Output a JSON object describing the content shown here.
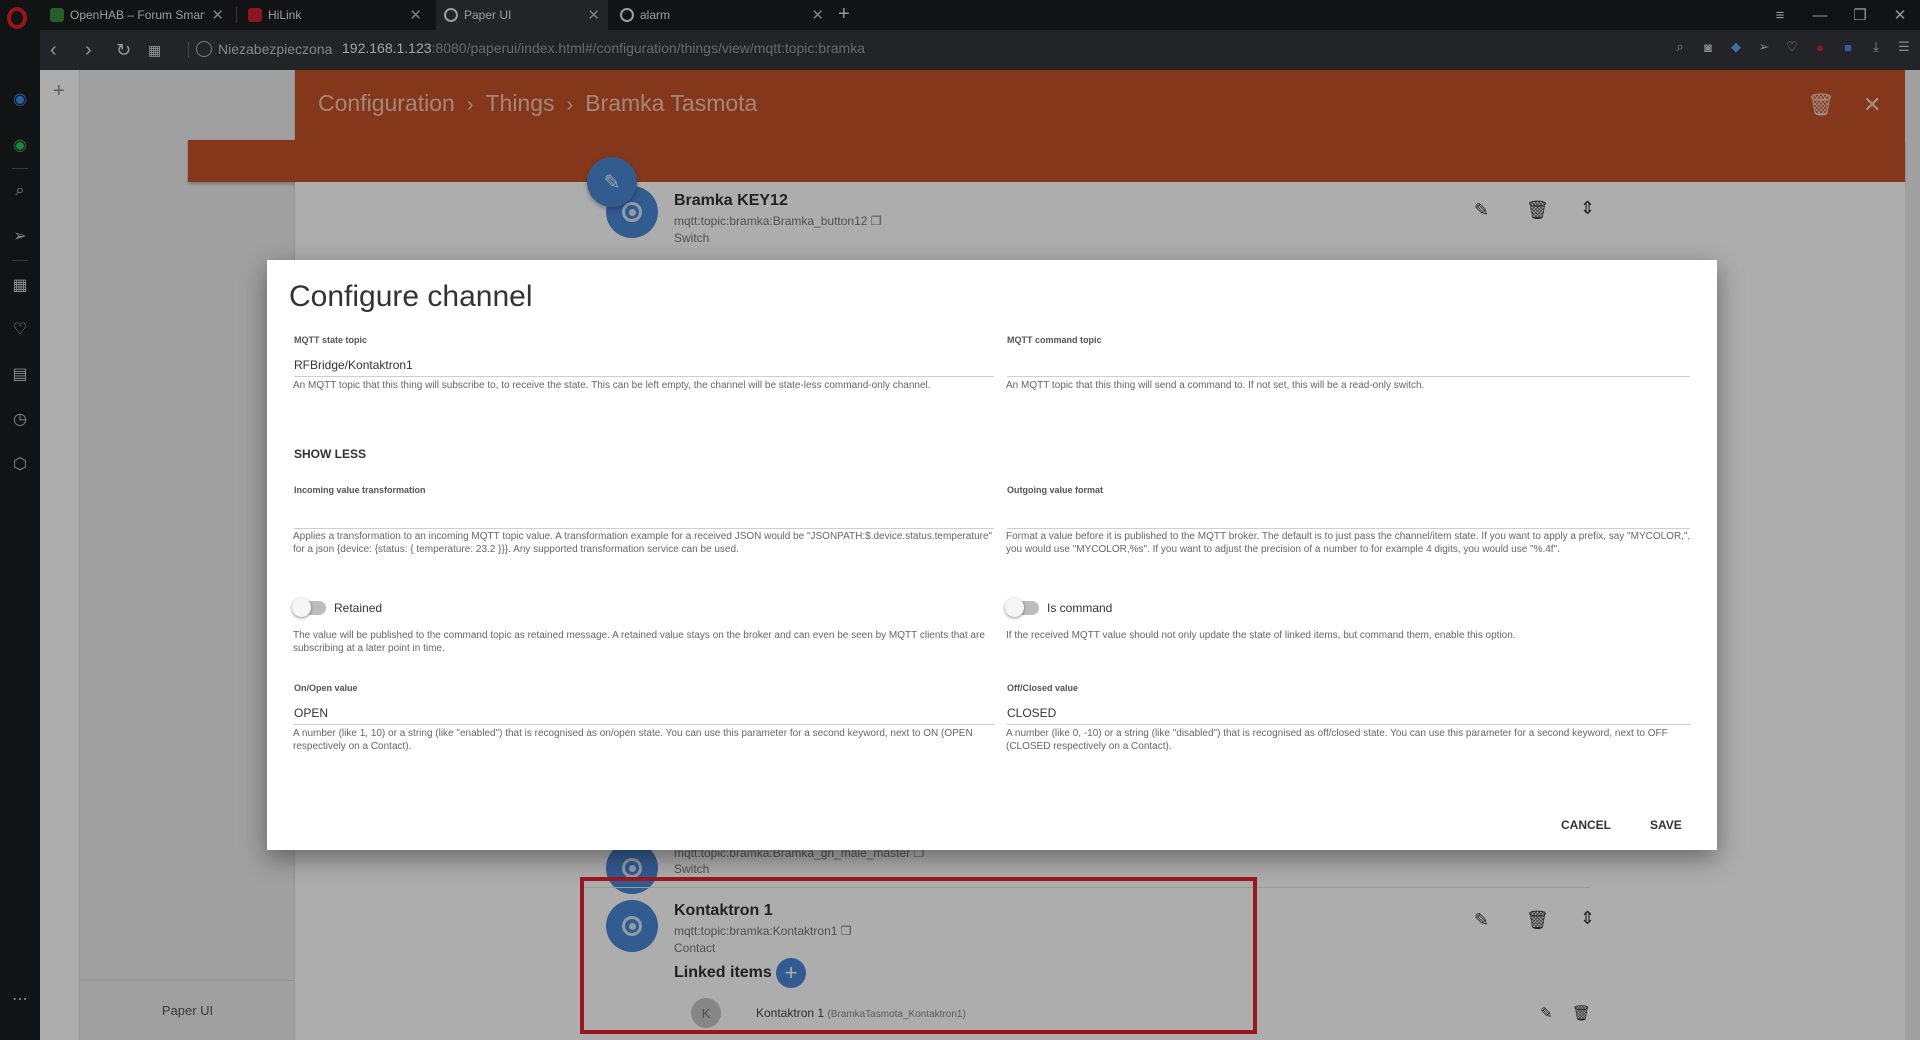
{
  "browser": {
    "tabs": [
      {
        "title": "OpenHAB – Forum Smartny",
        "favicon_color": "#3b8a3a"
      },
      {
        "title": "HiLink",
        "favicon_color": "#d01f2f"
      },
      {
        "title": "Paper UI",
        "favicon_color": "#e8e8e8"
      },
      {
        "title": "alarm",
        "favicon_color": "#e8e8e8"
      }
    ],
    "security_label": "Niezabezpieczona",
    "url_host": "192.168.1.123",
    "url_rest": ":8080/paperui/index.html#/configuration/things/view/mqtt:topic:bramka"
  },
  "app": {
    "footer_label": "Paper UI",
    "breadcrumb": [
      "Configuration",
      "Things",
      "Bramka Tasmota"
    ],
    "accent_color": "#c5512a"
  },
  "channels": [
    {
      "title": "Bramka KEY12",
      "uid": "mqtt:topic:bramka:Bramka_button12",
      "type": "Switch"
    },
    {
      "title": "",
      "uid": "mqtt:topic:bramka:Bramka_gn_male_master",
      "type": "Switch"
    },
    {
      "title": "Kontaktron 1",
      "uid": "mqtt:topic:bramka:Kontaktron1",
      "type": "Contact"
    }
  ],
  "linked": {
    "title": "Linked items",
    "item_initial": "K",
    "item_label": "Kontaktron 1",
    "item_sub": "(BramkaTasmota_Kontaktron1)"
  },
  "dialog": {
    "title": "Configure channel",
    "state_topic": {
      "label": "MQTT state topic",
      "value": "RFBridge/Kontaktron1",
      "help": "An MQTT topic that this thing will subscribe to, to receive the state. This can be left empty, the channel will be state-less command-only channel."
    },
    "command_topic": {
      "label": "MQTT command topic",
      "value": "",
      "help": "An MQTT topic that this thing will send a command to. If not set, this will be a read-only switch."
    },
    "show_less": "SHOW LESS",
    "incoming": {
      "label": "Incoming value transformation",
      "value": "",
      "help": "Applies a transformation to an incoming MQTT topic value. A transformation example for a received JSON would be \"JSONPATH:$.device.status.temperature\" for a json {device: {status: { temperature: 23.2 }}}. Any supported transformation service can be used."
    },
    "outgoing": {
      "label": "Outgoing value format",
      "value": "",
      "help": "Format a value before it is published to the MQTT broker. The default is to just pass the channel/item state. If you want to apply a prefix, say \"MYCOLOR,\", you would use \"MYCOLOR,%s\". If you want to adjust the precision of a number to for example 4 digits, you would use \"%.4f\"."
    },
    "retained": {
      "label": "Retained",
      "on": false,
      "help": "The value will be published to the command topic as retained message. A retained value stays on the broker and can even be seen by MQTT clients that are subscribing at a later point in time."
    },
    "is_command": {
      "label": "Is command",
      "on": false,
      "help": "If the received MQTT value should not only update the state of linked items, but command them, enable this option."
    },
    "on_value": {
      "label": "On/Open value",
      "value": "OPEN",
      "help": "A number (like 1, 10) or a string (like \"enabled\") that is recognised as on/open state. You can use this parameter for a second keyword, next to ON (OPEN respectively on a Contact)."
    },
    "off_value": {
      "label": "Off/Closed value",
      "value": "CLOSED",
      "help": "A number (like 0, -10) or a string (like \"disabled\") that is recognised as off/closed state. You can use this parameter for a second keyword, next to OFF (CLOSED respectively on a Contact)."
    },
    "cancel_label": "CANCEL",
    "save_label": "SAVE"
  },
  "icons": {
    "edit": "pencil-icon",
    "delete": "trash-icon",
    "expand": "expand-icon",
    "close": "close-icon"
  },
  "annotation": {
    "highlight_color": "#e3232d"
  }
}
